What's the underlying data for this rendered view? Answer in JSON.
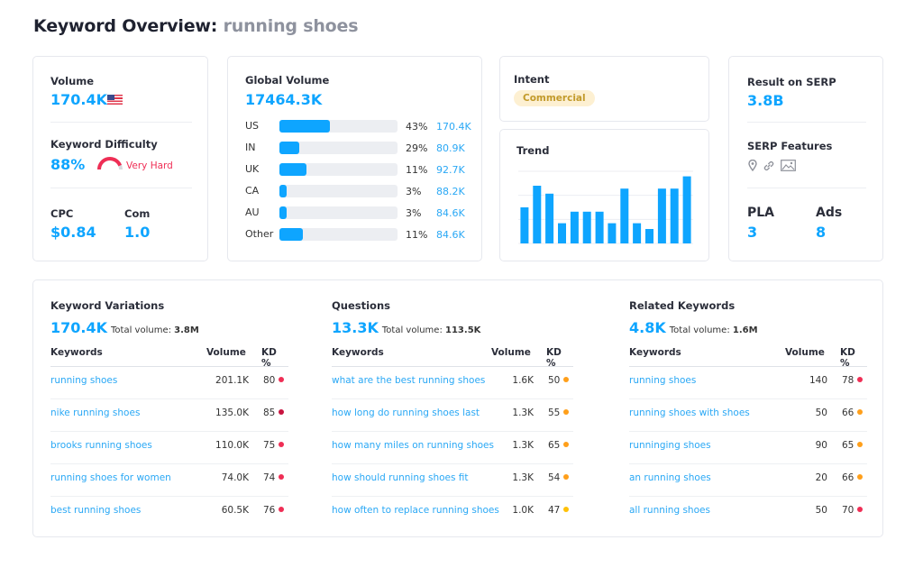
{
  "header": {
    "title_prefix": "Keyword Overview:",
    "keyword": "running shoes"
  },
  "colors": {
    "accent": "#0ea5ff",
    "hard": "#ef2e55",
    "medium": "#ff9f1a",
    "easy": "#ffc107",
    "intent_bg": "#fdf0d2",
    "intent_fg": "#c29a2a"
  },
  "summary": {
    "volume_label": "Volume",
    "volume": "170.4K",
    "volume_flag_icon": "us-flag-icon",
    "kd_label": "Keyword Difficulty",
    "kd": "88%",
    "kd_text": "Very Hard",
    "kd_fraction": 0.88,
    "cpc_label": "CPC",
    "cpc": "$0.84",
    "com_label": "Com",
    "com": "1.0"
  },
  "global_volume": {
    "label": "Global Volume",
    "total": "17464.3K",
    "rows": [
      {
        "country": "US",
        "pct": "43%",
        "share": 0.43,
        "volume": "170.4K"
      },
      {
        "country": "IN",
        "pct": "29%",
        "share": 0.17,
        "volume": "80.9K"
      },
      {
        "country": "UK",
        "pct": "11%",
        "share": 0.23,
        "volume": "92.7K"
      },
      {
        "country": "CA",
        "pct": "3%",
        "share": 0.06,
        "volume": "88.2K"
      },
      {
        "country": "AU",
        "pct": "3%",
        "share": 0.06,
        "volume": "84.6K"
      },
      {
        "country": "Other",
        "pct": "11%",
        "share": 0.2,
        "volume": "84.6K"
      }
    ]
  },
  "intent": {
    "label": "Intent",
    "value": "Commercial"
  },
  "trend": {
    "label": "Trend",
    "values": [
      0.5,
      0.8,
      0.69,
      0.28,
      0.44,
      0.44,
      0.44,
      0.28,
      0.76,
      0.28,
      0.2,
      0.76,
      0.76,
      0.93
    ]
  },
  "serp": {
    "result_label": "Result on SERP",
    "result": "3.8B",
    "features_label": "SERP Features",
    "features": [
      "location-pin-icon",
      "link-icon",
      "image-icon"
    ],
    "pla_label": "PLA",
    "pla": "3",
    "ads_label": "Ads",
    "ads": "8"
  },
  "tables": [
    {
      "title": "Keyword Variations",
      "count": "170.4K",
      "total_label": "Total volume:",
      "total": "3.8M",
      "headers": [
        "Keywords",
        "Volume",
        "KD %"
      ],
      "rows": [
        {
          "keyword": "running shoes",
          "volume": "201.1K",
          "kd": "80",
          "level": "hard"
        },
        {
          "keyword": "nike running shoes",
          "volume": "135.0K",
          "kd": "85",
          "level": "veryhard"
        },
        {
          "keyword": "brooks running shoes",
          "volume": "110.0K",
          "kd": "75",
          "level": "hard"
        },
        {
          "keyword": "running shoes for women",
          "volume": "74.0K",
          "kd": "74",
          "level": "hard"
        },
        {
          "keyword": "best running shoes",
          "volume": "60.5K",
          "kd": "76",
          "level": "hard"
        }
      ]
    },
    {
      "title": "Questions",
      "count": "13.3K",
      "total_label": "Total volume:",
      "total": "113.5K",
      "headers": [
        "Keywords",
        "Volume",
        "KD %"
      ],
      "rows": [
        {
          "keyword": "what are the best running shoes",
          "volume": "1.6K",
          "kd": "50",
          "level": "medium"
        },
        {
          "keyword": "how long do running shoes last",
          "volume": "1.3K",
          "kd": "55",
          "level": "medium"
        },
        {
          "keyword": "how many miles on running shoes",
          "volume": "1.3K",
          "kd": "65",
          "level": "medium"
        },
        {
          "keyword": "how should running shoes fit",
          "volume": "1.3K",
          "kd": "54",
          "level": "medium"
        },
        {
          "keyword": "how often to replace running shoes",
          "volume": "1.0K",
          "kd": "47",
          "level": "easy"
        }
      ]
    },
    {
      "title": "Related Keywords",
      "count": "4.8K",
      "total_label": "Total volume:",
      "total": "1.6M",
      "headers": [
        "Keywords",
        "Volume",
        "KD %"
      ],
      "rows": [
        {
          "keyword": "running shoes",
          "volume": "140",
          "kd": "78",
          "level": "hard"
        },
        {
          "keyword": "running shoes with shoes",
          "volume": "50",
          "kd": "66",
          "level": "medium"
        },
        {
          "keyword": "runninging shoes",
          "volume": "90",
          "kd": "65",
          "level": "medium"
        },
        {
          "keyword": "an running shoes",
          "volume": "20",
          "kd": "66",
          "level": "medium"
        },
        {
          "keyword": "all running shoes",
          "volume": "50",
          "kd": "70",
          "level": "hard"
        }
      ]
    }
  ]
}
